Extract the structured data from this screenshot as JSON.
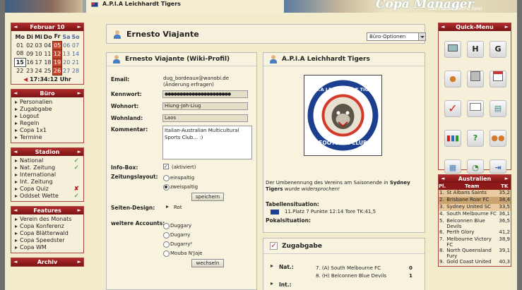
{
  "banner": {
    "club_name": "A.P.I.A Leichhardt Tigers",
    "logo_text": "Copa Manager",
    "tagline": "Das Fussball Online Spiel"
  },
  "calendar": {
    "title": "Februar 10",
    "days": [
      "Mo",
      "Di",
      "Mi",
      "Do",
      "Fr",
      "Sa",
      "So"
    ],
    "weeks": [
      [
        "01",
        "02",
        "03",
        "04",
        "05",
        "06",
        "07"
      ],
      [
        "08",
        "09",
        "10",
        "11",
        "12",
        "13",
        "14"
      ],
      [
        "15",
        "16",
        "17",
        "18",
        "19",
        "20",
        "21"
      ],
      [
        "22",
        "23",
        "24",
        "25",
        "26",
        "27",
        "28"
      ]
    ],
    "time": "17:34:12 Uhr"
  },
  "buero": {
    "title": "Büro",
    "items": [
      "Personalien",
      "Zugabgabe",
      "Logout",
      "Regeln",
      "Copa 1x1",
      "Termine"
    ]
  },
  "stadion": {
    "title": "Stadion",
    "items": [
      {
        "label": "National",
        "status": "✓"
      },
      {
        "label": "Nat. Zeitung",
        "status": "✓"
      },
      {
        "label": "International",
        "status": ""
      },
      {
        "label": "Int. Zeitung",
        "status": ""
      },
      {
        "label": "Copa Quiz",
        "status": "✘"
      },
      {
        "label": "Oddset Wette",
        "status": "✓"
      }
    ]
  },
  "features": {
    "title": "Features",
    "items": [
      "Verein des Monats",
      "Copa Konferenz",
      "Copa Blätterwald",
      "Copa Speedster",
      "Copa WM"
    ]
  },
  "archiv": {
    "title": "Archiv"
  },
  "header": {
    "title": "Ernesto Viajante",
    "dropdown": "Büro-Optionen"
  },
  "profile": {
    "title": "Ernesto Viajante (Wiki-Profil)",
    "email_label": "Email:",
    "email": "dug_bordeaux@wanobi.de",
    "email_note": "(Änderung erfragen)",
    "password_label": "Kennwort:",
    "password": "●●●●●●●●●●●●●●●●●●●●●●",
    "wohnort_label": "Wohnort:",
    "wohnort": "Hiung-Joh-Liug",
    "wohnland_label": "Wohnland:",
    "wohnland": "Laos",
    "kommentar_label": "Kommentar:",
    "kommentar": "Italian-Australian Multicultural Sports Club... :)",
    "infobox_label": "Info-Box:",
    "infobox_value": "(aktiviert)",
    "zeitung_label": "Zeitungslayout:",
    "opt1": "einspaltig",
    "opt2": "zweispaltig",
    "save_btn": "speichern",
    "design_label": "Seiten-Design:",
    "design_value": "Rot",
    "accounts_label": "weitere Accounts:",
    "accounts": [
      "Duggary",
      "Dugarry",
      "Dugarry²",
      "Mouba N'Jaje"
    ],
    "switch_btn": "wechseln"
  },
  "club": {
    "title": "A.P.I.A Leichhardt Tigers",
    "crest_top": "A.P.I.A LEICHHARDT TIGERS",
    "crest_bottom": "FOOTBALL CLUB",
    "rename_pre": "Der Umbenennung des Vereins am Saisonende in ",
    "rename_team": "Sydney Tigers",
    "rename_mid": " wurde ",
    "rename_post": "widersprochen!",
    "table_label": "Tabellensituation:",
    "table_value": "11.Platz 7 Punkte 12:14 Tore TK:41,5",
    "cup_label": "Pokalsituation:"
  },
  "zugabgabe": {
    "title": "Zugabgabe",
    "nat_label": "Nat.:",
    "nat_rows": [
      {
        "label": "7. (A) South Melbourne FC",
        "val": "0"
      },
      {
        "label": "8. (H) Belconnen Blue Devils",
        "val": "1"
      }
    ],
    "int_label": "Int.:"
  },
  "quickmenu": {
    "title": "Quick-Menu",
    "icons": [
      "monitor-icon",
      "h-icon",
      "g-icon",
      "person-icon",
      "newspaper-icon",
      "calendar-icon",
      "check-icon",
      "mail-icon",
      "board-icon",
      "chart-icon",
      "question-icon",
      "team-icon",
      "notes-icon",
      "pie-icon",
      "exit-icon"
    ]
  },
  "league": {
    "title": "Australien",
    "columns": [
      "Pl.",
      "Team",
      "TK"
    ],
    "rows": [
      [
        "1.",
        "St Albans Saints",
        "35,2"
      ],
      [
        "2.",
        "Brisbane Roar FC",
        "38,4"
      ],
      [
        "3.",
        "Sydney United SC",
        "33,5"
      ],
      [
        "4.",
        "South Melbourne FC",
        "36,1"
      ],
      [
        "5.",
        "Belconnen Blue Devils",
        "36,5"
      ],
      [
        "6.",
        "Perth Glory",
        "41,2"
      ],
      [
        "7.",
        "Melbourne Victory FC",
        "38,9"
      ],
      [
        "8.",
        "North Queensland Fury",
        "39,1"
      ],
      [
        "9.",
        "Gold Coast United",
        "40,3"
      ]
    ]
  }
}
